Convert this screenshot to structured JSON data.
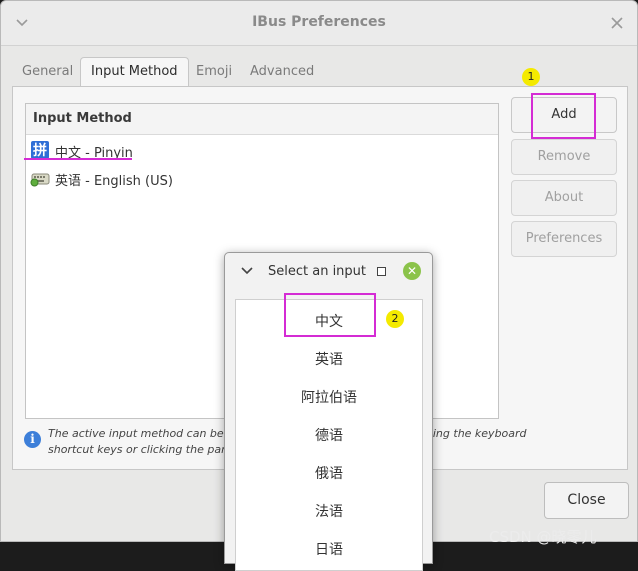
{
  "window": {
    "title": "IBus Preferences"
  },
  "tabs": [
    {
      "label": "General",
      "active": false
    },
    {
      "label": "Input Method",
      "active": true
    },
    {
      "label": "Emoji",
      "active": false
    },
    {
      "label": "Advanced",
      "active": false
    }
  ],
  "input_list": {
    "header": "Input Method",
    "items": [
      {
        "label": "中文 - Pinyin",
        "icon": "pinyin-icon"
      },
      {
        "label": "英语 - English (US)",
        "icon": "keyboard-icon"
      }
    ]
  },
  "buttons": {
    "add": "Add",
    "remove": "Remove",
    "about": "About",
    "preferences": "Preferences",
    "close": "Close"
  },
  "info": {
    "line1_left": "The active input method can be swit",
    "line1_right": "above list by pressing the keyboard",
    "line2_left": "shortcut keys or clicking the panel ic"
  },
  "select_dialog": {
    "title": "Select an input",
    "languages": [
      "中文",
      "英语",
      "阿拉伯语",
      "德语",
      "俄语",
      "法语",
      "日语"
    ]
  },
  "annotations": {
    "badge1": "1",
    "badge2": "2",
    "highlight_color": "#d42bd4",
    "badge_color": "#f4ea00"
  },
  "watermark": "CSDN @晓零儿"
}
